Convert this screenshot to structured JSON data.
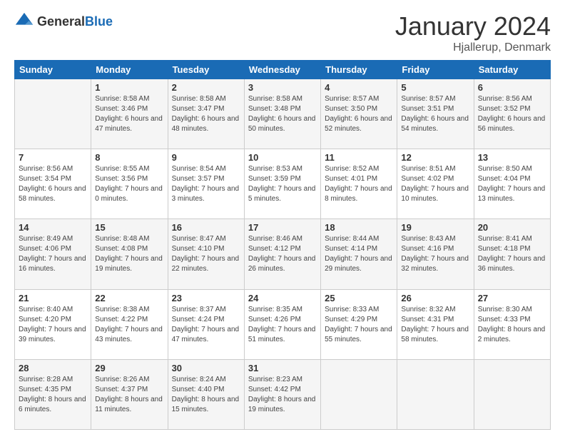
{
  "header": {
    "logo_general": "General",
    "logo_blue": "Blue",
    "month_title": "January 2024",
    "location": "Hjallerup, Denmark"
  },
  "days_of_week": [
    "Sunday",
    "Monday",
    "Tuesday",
    "Wednesday",
    "Thursday",
    "Friday",
    "Saturday"
  ],
  "weeks": [
    [
      {
        "day": "",
        "sunrise": "",
        "sunset": "",
        "daylight": ""
      },
      {
        "day": "1",
        "sunrise": "Sunrise: 8:58 AM",
        "sunset": "Sunset: 3:46 PM",
        "daylight": "Daylight: 6 hours and 47 minutes."
      },
      {
        "day": "2",
        "sunrise": "Sunrise: 8:58 AM",
        "sunset": "Sunset: 3:47 PM",
        "daylight": "Daylight: 6 hours and 48 minutes."
      },
      {
        "day": "3",
        "sunrise": "Sunrise: 8:58 AM",
        "sunset": "Sunset: 3:48 PM",
        "daylight": "Daylight: 6 hours and 50 minutes."
      },
      {
        "day": "4",
        "sunrise": "Sunrise: 8:57 AM",
        "sunset": "Sunset: 3:50 PM",
        "daylight": "Daylight: 6 hours and 52 minutes."
      },
      {
        "day": "5",
        "sunrise": "Sunrise: 8:57 AM",
        "sunset": "Sunset: 3:51 PM",
        "daylight": "Daylight: 6 hours and 54 minutes."
      },
      {
        "day": "6",
        "sunrise": "Sunrise: 8:56 AM",
        "sunset": "Sunset: 3:52 PM",
        "daylight": "Daylight: 6 hours and 56 minutes."
      }
    ],
    [
      {
        "day": "7",
        "sunrise": "Sunrise: 8:56 AM",
        "sunset": "Sunset: 3:54 PM",
        "daylight": "Daylight: 6 hours and 58 minutes."
      },
      {
        "day": "8",
        "sunrise": "Sunrise: 8:55 AM",
        "sunset": "Sunset: 3:56 PM",
        "daylight": "Daylight: 7 hours and 0 minutes."
      },
      {
        "day": "9",
        "sunrise": "Sunrise: 8:54 AM",
        "sunset": "Sunset: 3:57 PM",
        "daylight": "Daylight: 7 hours and 3 minutes."
      },
      {
        "day": "10",
        "sunrise": "Sunrise: 8:53 AM",
        "sunset": "Sunset: 3:59 PM",
        "daylight": "Daylight: 7 hours and 5 minutes."
      },
      {
        "day": "11",
        "sunrise": "Sunrise: 8:52 AM",
        "sunset": "Sunset: 4:01 PM",
        "daylight": "Daylight: 7 hours and 8 minutes."
      },
      {
        "day": "12",
        "sunrise": "Sunrise: 8:51 AM",
        "sunset": "Sunset: 4:02 PM",
        "daylight": "Daylight: 7 hours and 10 minutes."
      },
      {
        "day": "13",
        "sunrise": "Sunrise: 8:50 AM",
        "sunset": "Sunset: 4:04 PM",
        "daylight": "Daylight: 7 hours and 13 minutes."
      }
    ],
    [
      {
        "day": "14",
        "sunrise": "Sunrise: 8:49 AM",
        "sunset": "Sunset: 4:06 PM",
        "daylight": "Daylight: 7 hours and 16 minutes."
      },
      {
        "day": "15",
        "sunrise": "Sunrise: 8:48 AM",
        "sunset": "Sunset: 4:08 PM",
        "daylight": "Daylight: 7 hours and 19 minutes."
      },
      {
        "day": "16",
        "sunrise": "Sunrise: 8:47 AM",
        "sunset": "Sunset: 4:10 PM",
        "daylight": "Daylight: 7 hours and 22 minutes."
      },
      {
        "day": "17",
        "sunrise": "Sunrise: 8:46 AM",
        "sunset": "Sunset: 4:12 PM",
        "daylight": "Daylight: 7 hours and 26 minutes."
      },
      {
        "day": "18",
        "sunrise": "Sunrise: 8:44 AM",
        "sunset": "Sunset: 4:14 PM",
        "daylight": "Daylight: 7 hours and 29 minutes."
      },
      {
        "day": "19",
        "sunrise": "Sunrise: 8:43 AM",
        "sunset": "Sunset: 4:16 PM",
        "daylight": "Daylight: 7 hours and 32 minutes."
      },
      {
        "day": "20",
        "sunrise": "Sunrise: 8:41 AM",
        "sunset": "Sunset: 4:18 PM",
        "daylight": "Daylight: 7 hours and 36 minutes."
      }
    ],
    [
      {
        "day": "21",
        "sunrise": "Sunrise: 8:40 AM",
        "sunset": "Sunset: 4:20 PM",
        "daylight": "Daylight: 7 hours and 39 minutes."
      },
      {
        "day": "22",
        "sunrise": "Sunrise: 8:38 AM",
        "sunset": "Sunset: 4:22 PM",
        "daylight": "Daylight: 7 hours and 43 minutes."
      },
      {
        "day": "23",
        "sunrise": "Sunrise: 8:37 AM",
        "sunset": "Sunset: 4:24 PM",
        "daylight": "Daylight: 7 hours and 47 minutes."
      },
      {
        "day": "24",
        "sunrise": "Sunrise: 8:35 AM",
        "sunset": "Sunset: 4:26 PM",
        "daylight": "Daylight: 7 hours and 51 minutes."
      },
      {
        "day": "25",
        "sunrise": "Sunrise: 8:33 AM",
        "sunset": "Sunset: 4:29 PM",
        "daylight": "Daylight: 7 hours and 55 minutes."
      },
      {
        "day": "26",
        "sunrise": "Sunrise: 8:32 AM",
        "sunset": "Sunset: 4:31 PM",
        "daylight": "Daylight: 7 hours and 58 minutes."
      },
      {
        "day": "27",
        "sunrise": "Sunrise: 8:30 AM",
        "sunset": "Sunset: 4:33 PM",
        "daylight": "Daylight: 8 hours and 2 minutes."
      }
    ],
    [
      {
        "day": "28",
        "sunrise": "Sunrise: 8:28 AM",
        "sunset": "Sunset: 4:35 PM",
        "daylight": "Daylight: 8 hours and 6 minutes."
      },
      {
        "day": "29",
        "sunrise": "Sunrise: 8:26 AM",
        "sunset": "Sunset: 4:37 PM",
        "daylight": "Daylight: 8 hours and 11 minutes."
      },
      {
        "day": "30",
        "sunrise": "Sunrise: 8:24 AM",
        "sunset": "Sunset: 4:40 PM",
        "daylight": "Daylight: 8 hours and 15 minutes."
      },
      {
        "day": "31",
        "sunrise": "Sunrise: 8:23 AM",
        "sunset": "Sunset: 4:42 PM",
        "daylight": "Daylight: 8 hours and 19 minutes."
      },
      {
        "day": "",
        "sunrise": "",
        "sunset": "",
        "daylight": ""
      },
      {
        "day": "",
        "sunrise": "",
        "sunset": "",
        "daylight": ""
      },
      {
        "day": "",
        "sunrise": "",
        "sunset": "",
        "daylight": ""
      }
    ]
  ]
}
